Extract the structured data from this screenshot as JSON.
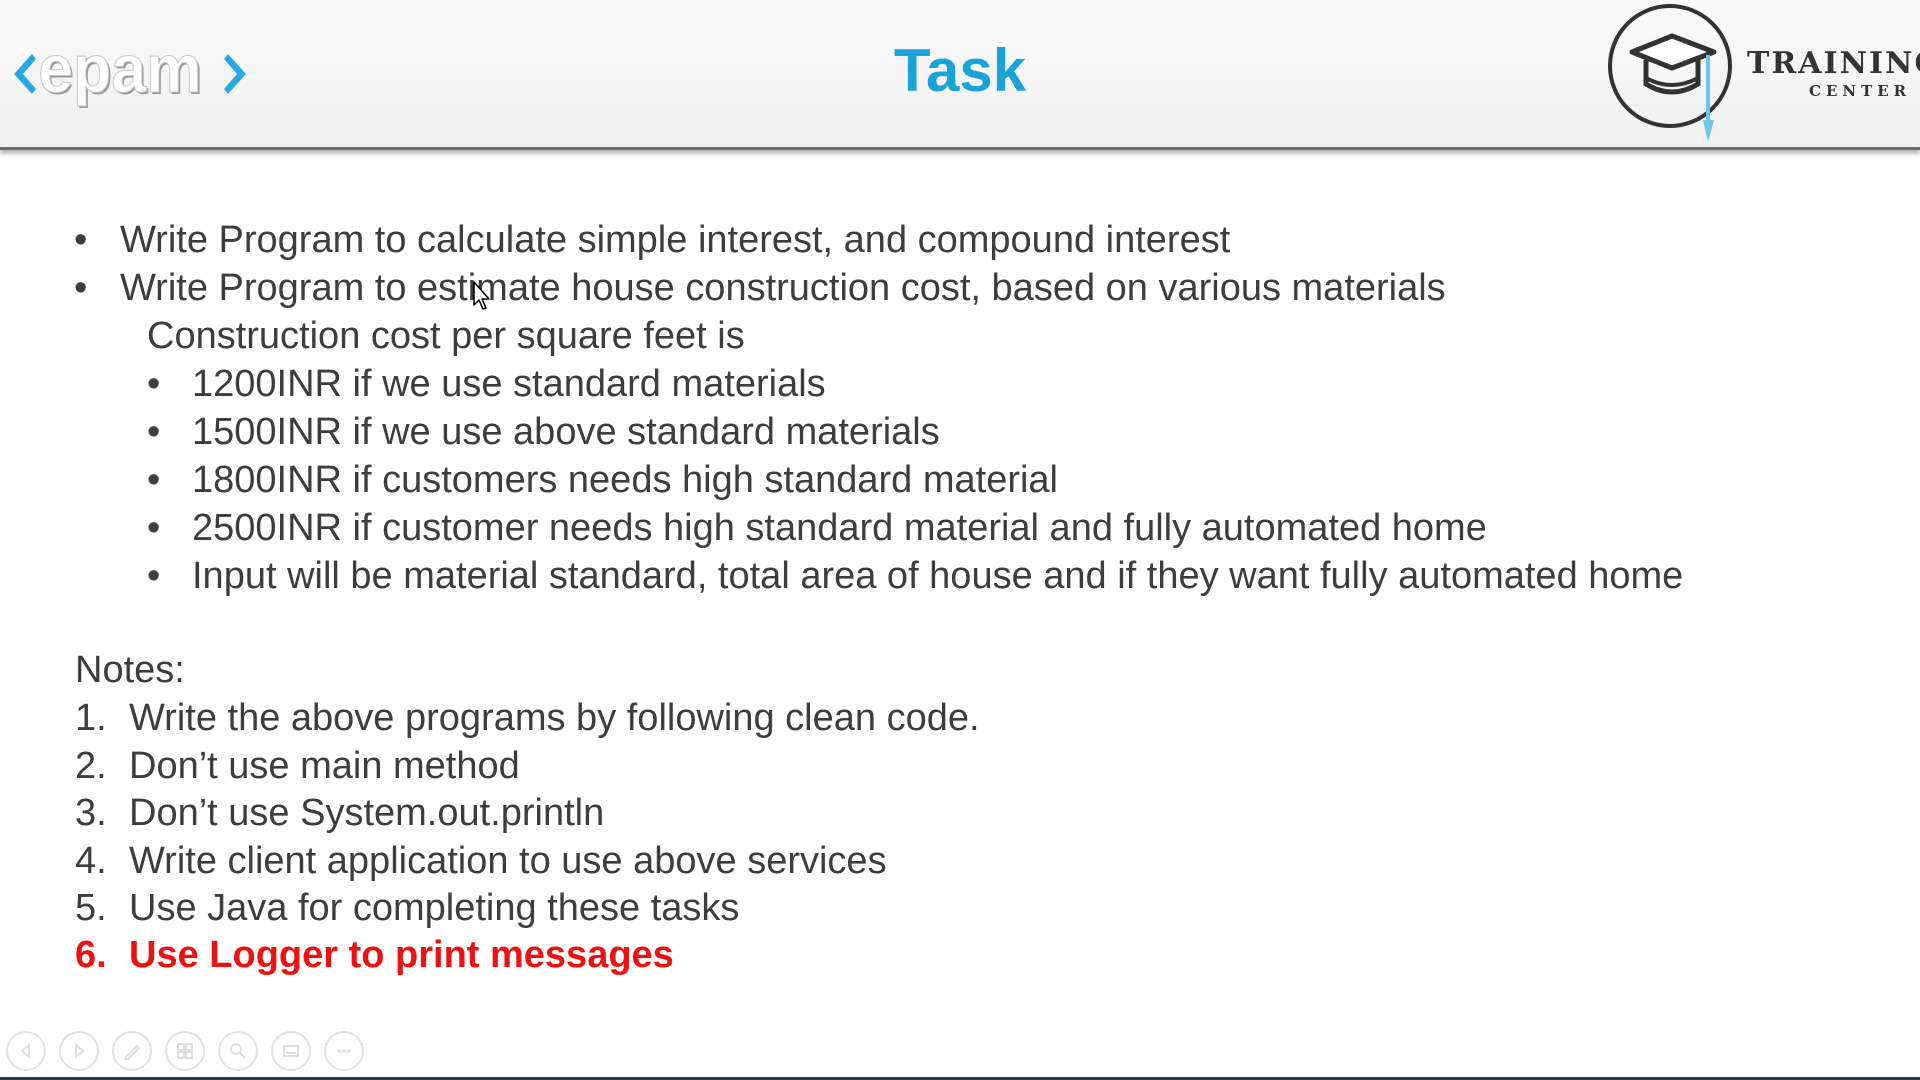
{
  "header": {
    "title": "Task",
    "epam_logo_text": "<epam>",
    "training_center": {
      "line1": "TRAINING",
      "line2": "CENTER"
    }
  },
  "tasks": [
    "Write Program to calculate simple interest, and compound interest",
    "Write Program to estimate house construction cost, based on various materials"
  ],
  "construction_intro": "Construction cost per square feet is",
  "construction_items": [
    "1200INR if we use standard materials",
    "1500INR if we use above standard materials",
    "1800INR if customers needs high standard material",
    "2500INR if customer needs high standard material and fully automated home",
    "Input will be material standard, total area of house and if they want fully automated home"
  ],
  "notes": {
    "heading": "Notes:",
    "items": [
      {
        "num": "1.",
        "text": "Write the above programs by following clean code."
      },
      {
        "num": "2.",
        "text": "Don’t use main method"
      },
      {
        "num": "3.",
        "text": "Don’t use System.out.println"
      },
      {
        "num": "4.",
        "text": "Write client application to use above services"
      },
      {
        "num": "5.",
        "text": "Use Java for completing these tasks"
      },
      {
        "num": "6.",
        "text": "Use Logger to print messages"
      }
    ]
  },
  "toolbar": [
    "prev-icon",
    "next-icon",
    "pen-icon",
    "slides-icon",
    "zoom-icon",
    "subtitles-icon",
    "more-icon"
  ],
  "colors": {
    "title": "#1aa3d9",
    "highlight": "#ee1111",
    "text": "#3d3d3d"
  }
}
